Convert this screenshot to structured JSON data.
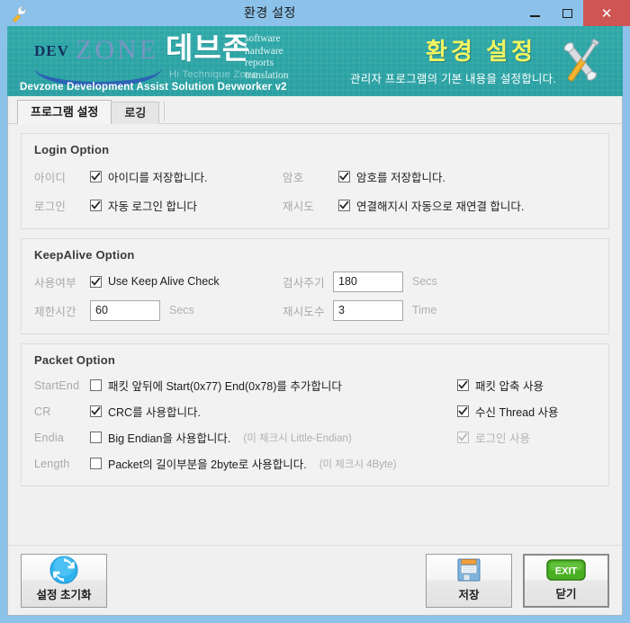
{
  "window": {
    "title": "환경 설정",
    "icon": "wrench-icon",
    "controls": {
      "minimize": "–",
      "maximize": "□",
      "close": "✕"
    },
    "border_color": "#8cc2ea",
    "close_color": "#cf5454"
  },
  "banner": {
    "brand_dev": "DEV",
    "brand_zone": "ZONE",
    "brand_kr": "데브존",
    "brand_sub": "Hi Technique Zone",
    "keywords": [
      "software",
      "hardware",
      "reports",
      "translation"
    ],
    "tagline": "Devzone Development Assist Solution Devworker v2",
    "title": "환경 설정",
    "subtitle": "관리자 프로그램의 기본 내용을 설정합니다.",
    "icon": "wrench-screwdriver-icon",
    "bg_color": "#2aa3a4",
    "title_color": "#f2f561"
  },
  "tabs": [
    {
      "label": "프로그램 설정",
      "active": true
    },
    {
      "label": "로깅",
      "active": false
    }
  ],
  "login_option": {
    "title": "Login Option",
    "rows": [
      {
        "left_label": "아이디",
        "left_checkbox": {
          "label": "아이디를 저장합니다.",
          "checked": true,
          "disabled": false
        },
        "right_label": "암호",
        "right_checkbox": {
          "label": "암호를 저장합니다.",
          "checked": true,
          "disabled": false
        }
      },
      {
        "left_label": "로그인",
        "left_checkbox": {
          "label": "자동 로그인 합니다",
          "checked": true,
          "disabled": false
        },
        "right_label": "재시도",
        "right_checkbox": {
          "label": "연결해지시 자동으로 재연결 합니다.",
          "checked": true,
          "disabled": false
        }
      }
    ]
  },
  "keepalive_option": {
    "title": "KeepAlive Option",
    "use_label": "사용여부",
    "use_checkbox": {
      "label": "Use Keep Alive Check",
      "checked": true
    },
    "interval_label": "검사주기",
    "interval_value": "180",
    "interval_unit": "Secs",
    "timeout_label": "제한시간",
    "timeout_value": "60",
    "timeout_unit": "Secs",
    "retry_label": "재시도수",
    "retry_value": "3",
    "retry_unit": "Time"
  },
  "packet_option": {
    "title": "Packet Option",
    "rows": [
      {
        "label": "StartEnd",
        "checkbox": {
          "label": "패킷 앞뒤에 Start(0x77) End(0x78)를 추가합니다",
          "checked": false,
          "disabled": false
        },
        "hint": ""
      },
      {
        "label": "CR",
        "checkbox": {
          "label": "CRC를 사용합니다.",
          "checked": true,
          "disabled": false
        },
        "hint": ""
      },
      {
        "label": "Endia",
        "checkbox": {
          "label": "Big Endian을 사용합니다.",
          "checked": false,
          "disabled": false
        },
        "hint": "(미 체크시 Little-Endian)"
      },
      {
        "label": "Length",
        "checkbox": {
          "label": "Packet의 길이부분을 2byte로 사용합니다.",
          "checked": false,
          "disabled": false
        },
        "hint": "(미 체크시 4Byte)"
      }
    ],
    "right_checkboxes": [
      {
        "label": "패킷 압축 사용",
        "checked": true,
        "disabled": false
      },
      {
        "label": "수신 Thread 사용",
        "checked": true,
        "disabled": false
      },
      {
        "label": "로그인 사용",
        "checked": true,
        "disabled": true
      }
    ]
  },
  "footer": {
    "reset_button": {
      "label": "설정 초기화",
      "icon": "refresh-icon"
    },
    "save_button": {
      "label": "저장",
      "icon": "floppy-disk-icon"
    },
    "close_button": {
      "label": "닫기",
      "icon": "exit-icon",
      "badge": "EXIT"
    }
  }
}
